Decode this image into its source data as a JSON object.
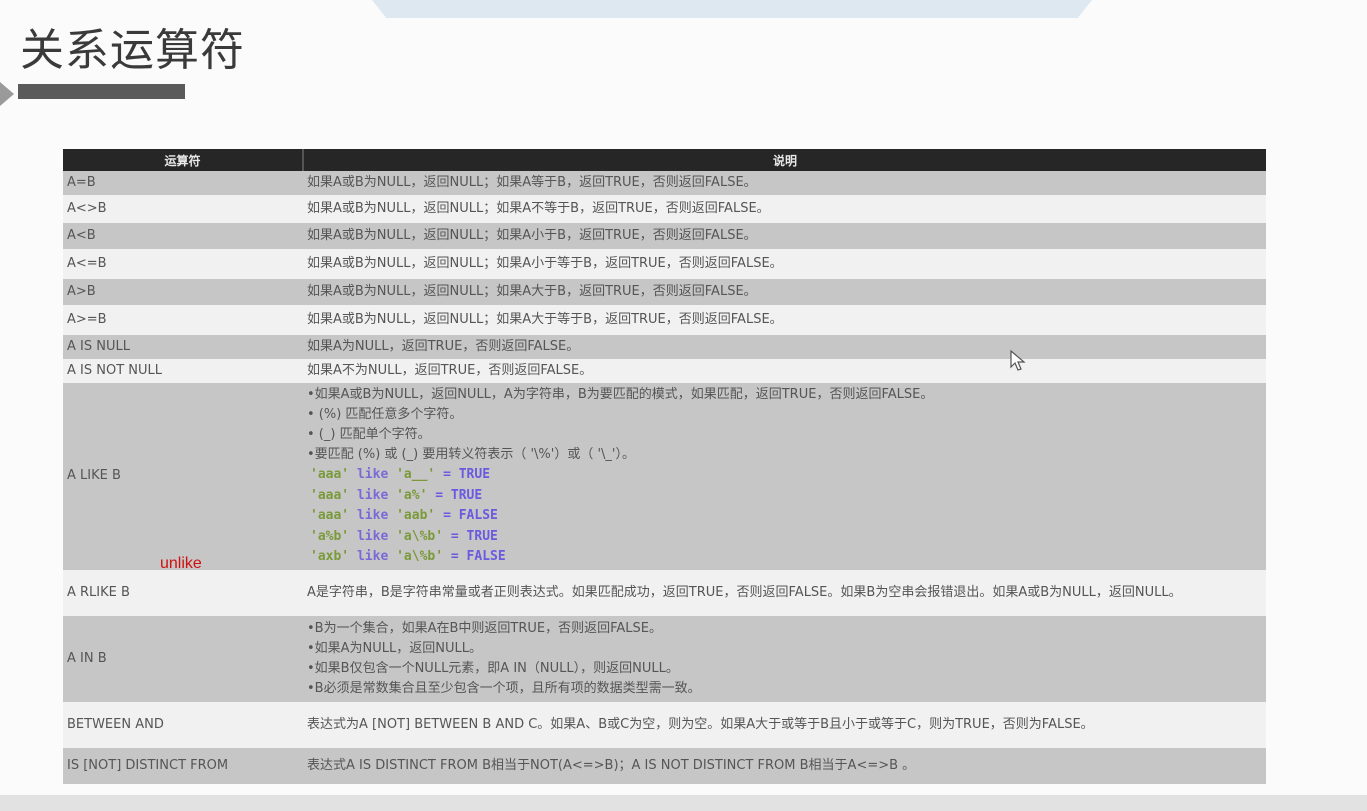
{
  "slide": {
    "title": "关系运算符",
    "annotation": "unlike",
    "accent_color": "#5a5a5a",
    "annotation_color": "#d01010"
  },
  "table": {
    "headers": {
      "operator": "运算符",
      "description": "说明"
    },
    "rows": [
      {
        "op": "A=B",
        "desc": [
          "如果A或B为NULL，返回NULL；如果A等于B，返回TRUE，否则返回FALSE。"
        ]
      },
      {
        "op": "A<>B",
        "desc": [
          "如果A或B为NULL，返回NULL；如果A不等于B，返回TRUE，否则返回FALSE。"
        ]
      },
      {
        "op": "A<B",
        "desc": [
          "如果A或B为NULL，返回NULL；如果A小于B，返回TRUE，否则返回FALSE。"
        ]
      },
      {
        "op": "A<=B",
        "desc": [
          "如果A或B为NULL，返回NULL；如果A小于等于B，返回TRUE，否则返回FALSE。"
        ]
      },
      {
        "op": "A>B",
        "desc": [
          "如果A或B为NULL，返回NULL；如果A大于B，返回TRUE，否则返回FALSE。"
        ]
      },
      {
        "op": "A>=B",
        "desc": [
          "如果A或B为NULL，返回NULL；如果A大于等于B，返回TRUE，否则返回FALSE。"
        ]
      },
      {
        "op": "A IS NULL",
        "desc": [
          "如果A为NULL，返回TRUE，否则返回FALSE。"
        ]
      },
      {
        "op": "A IS NOT NULL",
        "desc": [
          "如果A不为NULL，返回TRUE，否则返回FALSE。"
        ]
      },
      {
        "op": "A LIKE B",
        "desc": [
          "•如果A或B为NULL，返回NULL，A为字符串，B为要匹配的模式，如果匹配，返回TRUE，否则返回FALSE。",
          "• (%) 匹配任意多个字符。",
          "• (_) 匹配单个字符。",
          "•要匹配 (%) 或 (_) 要用转义符表示（ '\\%'）或（ '\\_'）。"
        ],
        "examples": [
          {
            "left": "'aaa'",
            "kw": "like",
            "right": "'a__'",
            "result": "= TRUE"
          },
          {
            "left": "'aaa'",
            "kw": "like",
            "right": "'a%'",
            "result": "= TRUE"
          },
          {
            "left": "'aaa'",
            "kw": "like",
            "right": "'aab'",
            "result": "= FALSE"
          },
          {
            "left": "'a%b'",
            "kw": "like",
            "right": "'a\\%b'",
            "result": "= TRUE"
          },
          {
            "left": "'axb'",
            "kw": "like",
            "right": "'a\\%b'",
            "result": "= FALSE"
          }
        ]
      },
      {
        "op": "A RLIKE B",
        "desc": [
          "A是字符串，B是字符串常量或者正则表达式。如果匹配成功，返回TRUE，否则返回FALSE。如果B为空串会报错退出。如果A或B为NULL，返回NULL。"
        ]
      },
      {
        "op": "A IN B",
        "desc": [
          "•B为一个集合，如果A在B中则返回TRUE，否则返回FALSE。",
          "•如果A为NULL，返回NULL。",
          "•如果B仅包含一个NULL元素，即A IN（NULL），则返回NULL。",
          "•B必须是常数集合且至少包含一个项，且所有项的数据类型需一致。"
        ]
      },
      {
        "op": "BETWEEN AND",
        "desc": [
          "表达式为A [NOT] BETWEEN B AND C。如果A、B或C为空，则为空。如果A大于或等于B且小于或等于C，则为TRUE，否则为FALSE。"
        ]
      },
      {
        "op": "IS [NOT] DISTINCT FROM",
        "desc": [
          "表达式A IS DISTINCT FROM B相当于NOT(A<=>B)；A IS NOT DISTINCT FROM B相当于A<=>B 。"
        ]
      }
    ]
  }
}
